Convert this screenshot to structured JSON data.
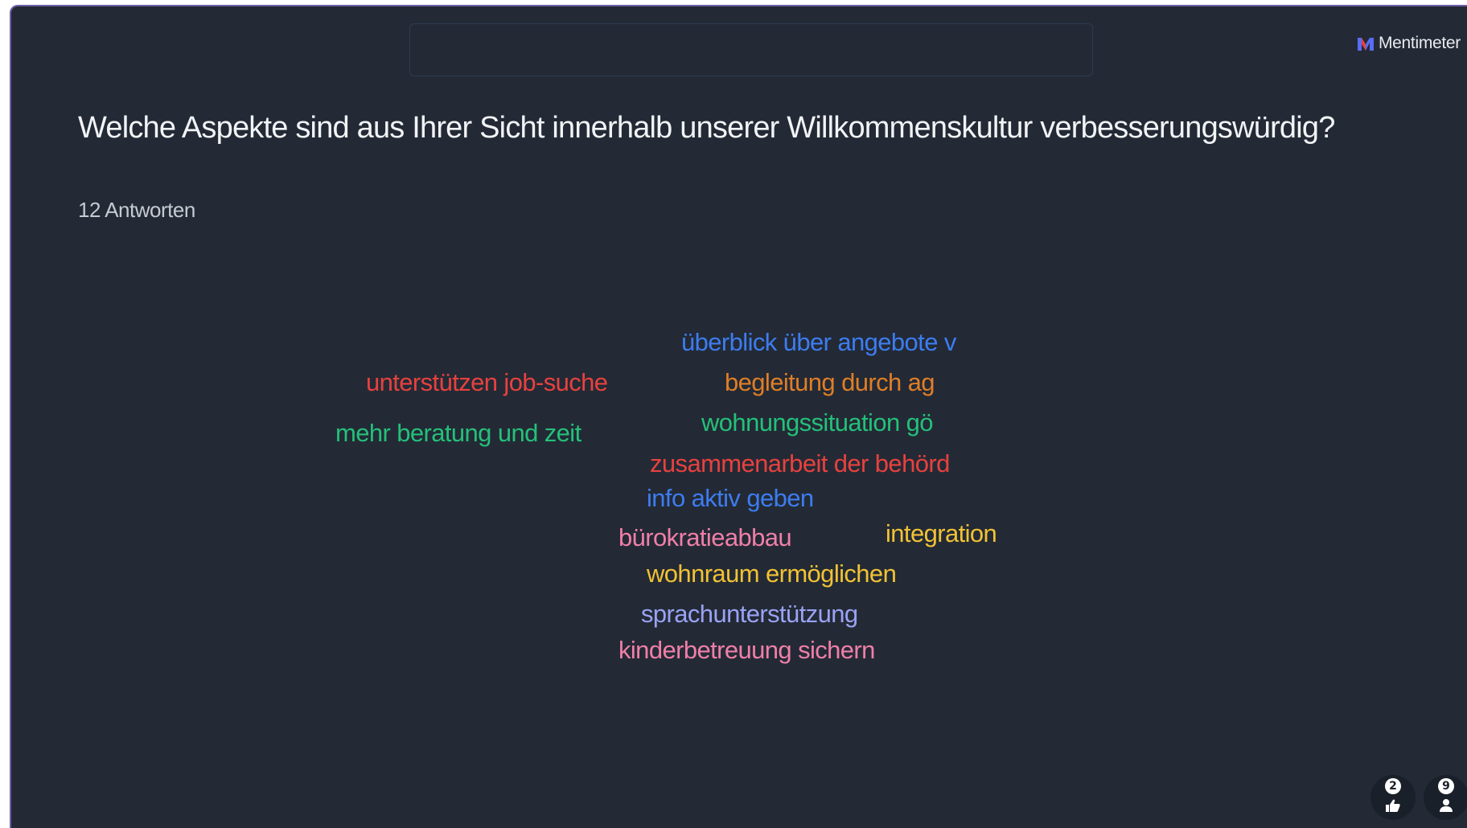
{
  "brand": {
    "name": "Mentimeter",
    "logo_colors": [
      "#5a6cf5",
      "#e8403a"
    ]
  },
  "slide": {
    "question": "Welche Aspekte sind aus Ihrer Sicht innerhalb unserer Willkommenskultur verbesserungswürdig?",
    "responses_label": "12 Antworten",
    "background": "#232a35"
  },
  "word_cloud": {
    "words": [
      {
        "text": "überblick über angebote v",
        "color": "#3d7cf0"
      },
      {
        "text": "unterstützen job-suche",
        "color": "#e8413f"
      },
      {
        "text": "begleitung durch ag",
        "color": "#e07e27"
      },
      {
        "text": "mehr beratung und zeit",
        "color": "#24c07a"
      },
      {
        "text": "wohnungssituation gö",
        "color": "#24c07a"
      },
      {
        "text": "zusammenarbeit der behörd",
        "color": "#e8413f"
      },
      {
        "text": "info aktiv geben",
        "color": "#3d7cf0"
      },
      {
        "text": "bürokratieabbau",
        "color": "#f07fa8"
      },
      {
        "text": "integration",
        "color": "#f2c234"
      },
      {
        "text": "wohnraum ermöglichen",
        "color": "#f2c234"
      },
      {
        "text": "sprachunterstützung",
        "color": "#9aa2f5"
      },
      {
        "text": "kinderbetreuung sichern",
        "color": "#f07fa8"
      }
    ]
  },
  "controls": {
    "likes_count": "2",
    "participants_count": "9",
    "like_icon": "thumbs-up-icon",
    "participant_icon": "person-icon"
  }
}
